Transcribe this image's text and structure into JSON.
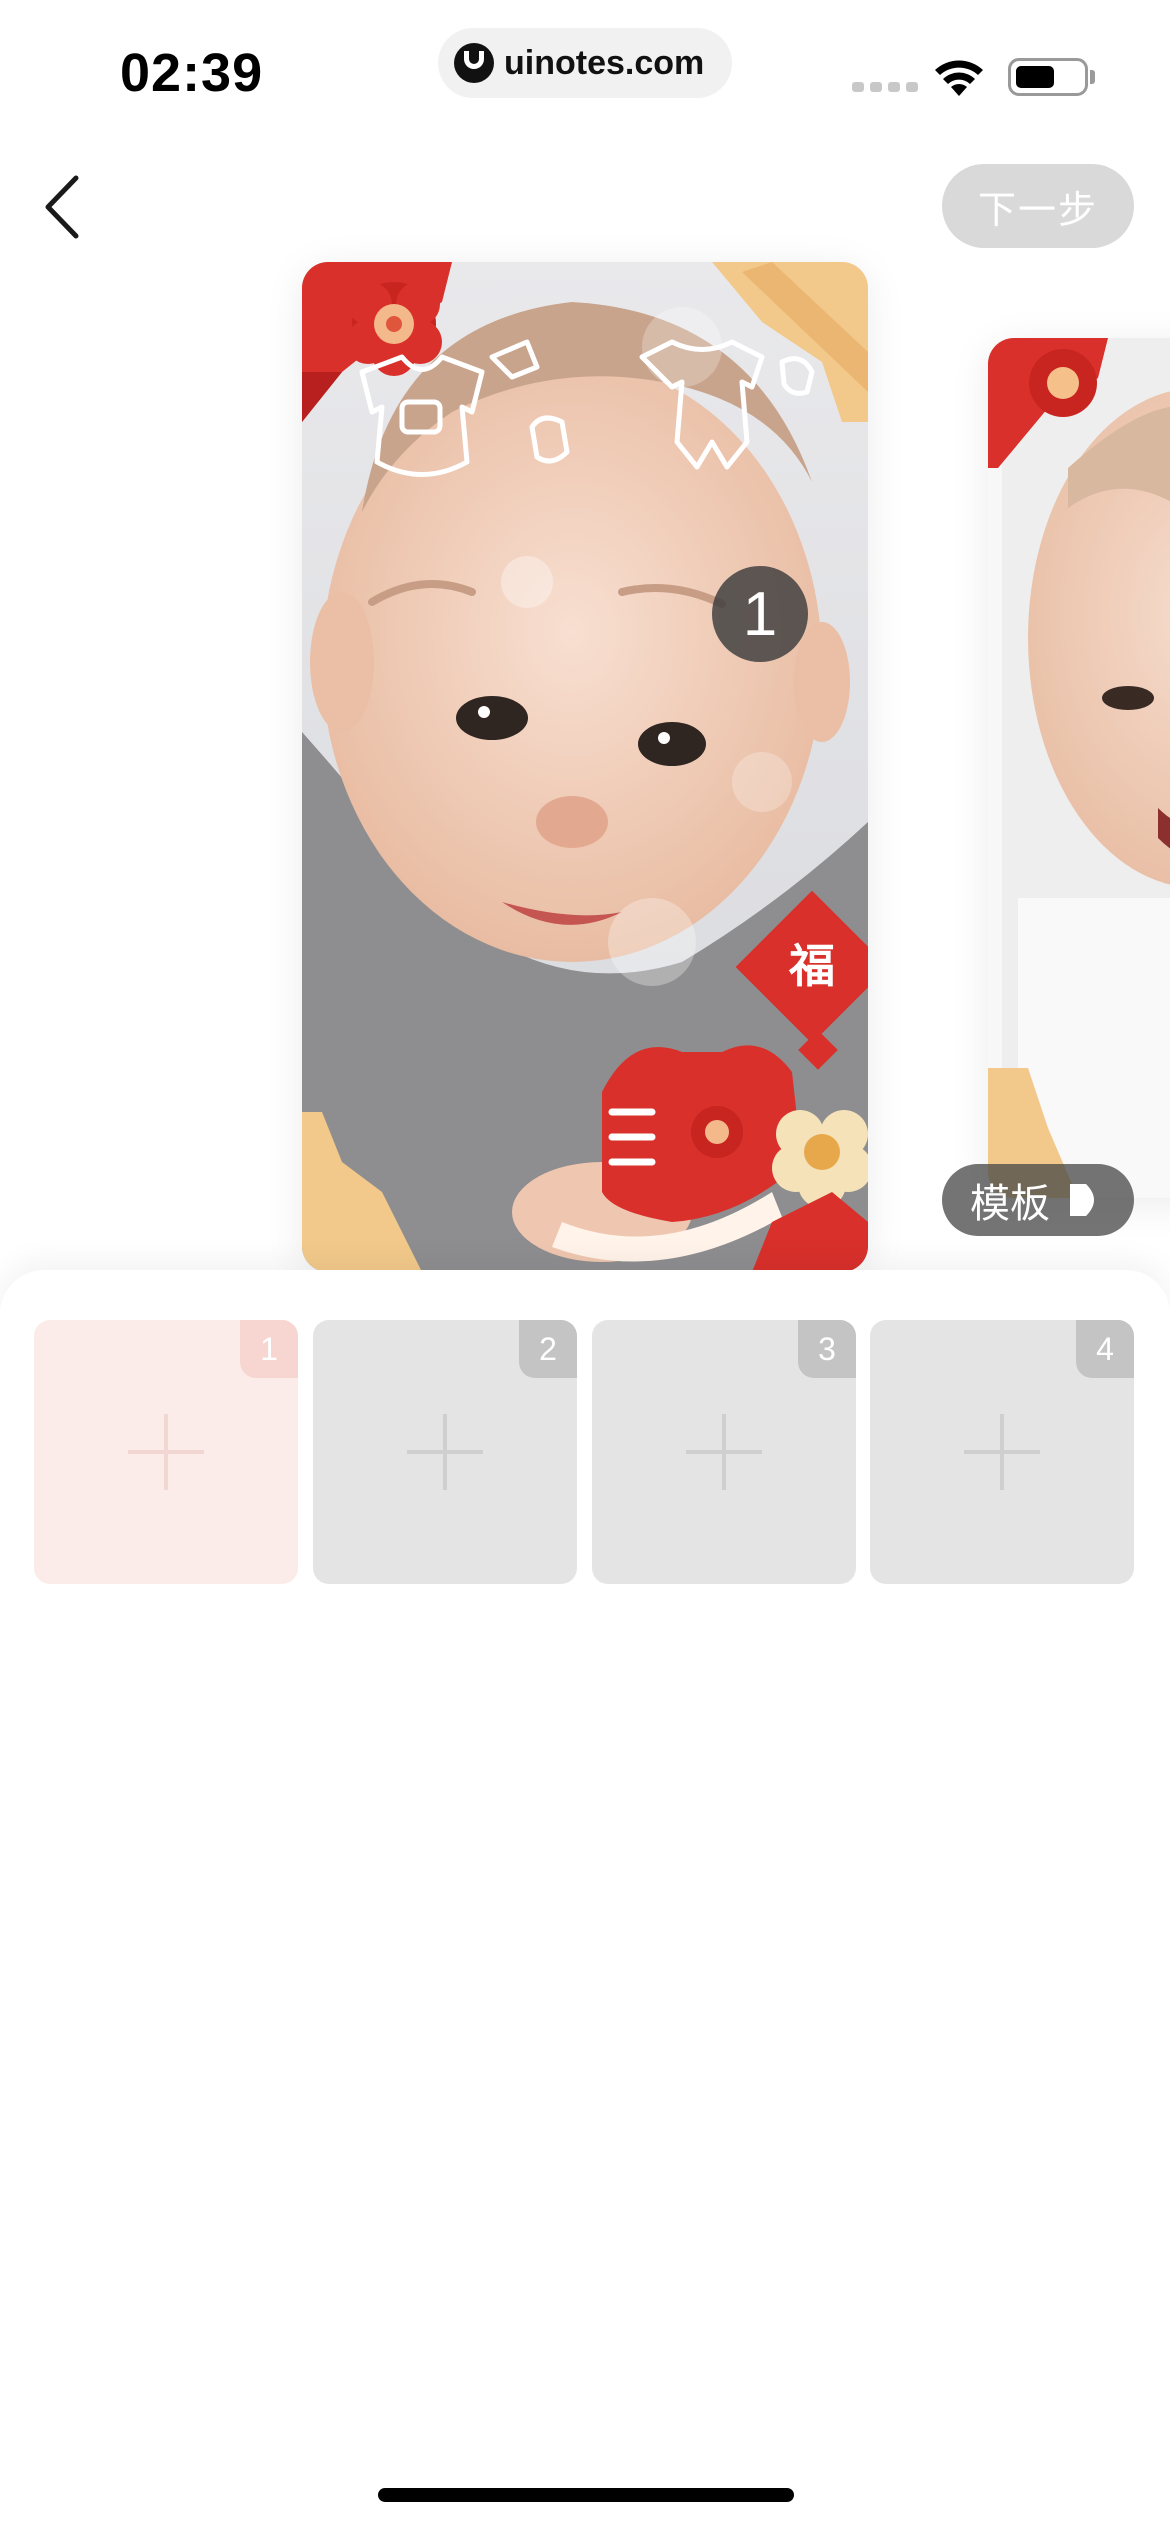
{
  "status_bar": {
    "time": "02:39",
    "url": "uinotes.com"
  },
  "nav": {
    "next_label": "下一步"
  },
  "preview": {
    "badge_number": "1",
    "fu_character": "福",
    "template_label": "模板"
  },
  "slots": [
    {
      "number": "1",
      "active": true
    },
    {
      "number": "2",
      "active": false
    },
    {
      "number": "3",
      "active": false
    },
    {
      "number": "4",
      "active": false
    }
  ],
  "colors": {
    "accent_red": "#d9302b",
    "gold": "#f2c98a",
    "next_disabled": "#d9d9d9"
  }
}
